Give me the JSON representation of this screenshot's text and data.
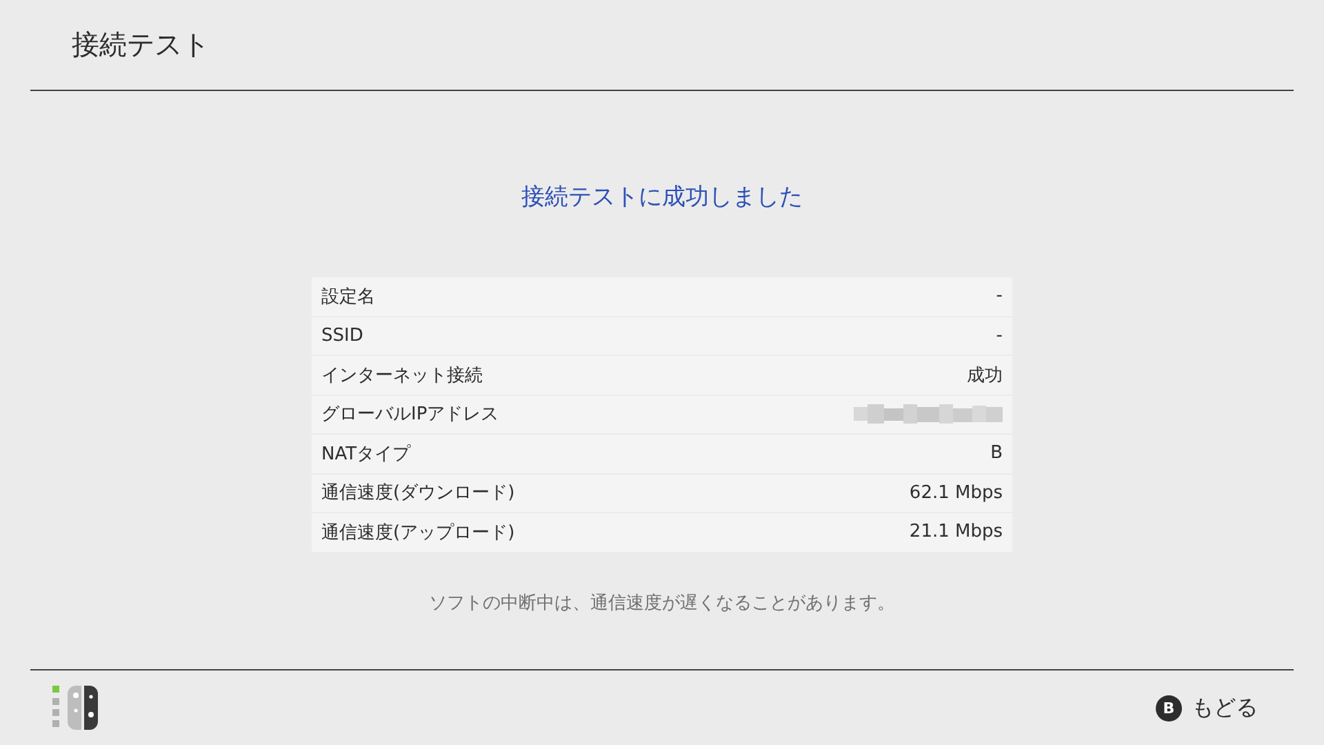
{
  "header": {
    "title": "接続テスト"
  },
  "result_message": "接続テストに成功しました",
  "rows": [
    {
      "kind": "text",
      "label": "設定名",
      "value": "-"
    },
    {
      "kind": "text",
      "label": "SSID",
      "value": "-"
    },
    {
      "kind": "text",
      "label": "インターネット接続",
      "value": "成功"
    },
    {
      "kind": "redacted",
      "label": "グローバルIPアドレス"
    },
    {
      "kind": "text",
      "label": "NATタイプ",
      "value": "B"
    },
    {
      "kind": "text",
      "label": "通信速度(ダウンロード)",
      "value": "62.1 Mbps"
    },
    {
      "kind": "text",
      "label": "通信速度(アップロード)",
      "value": "21.1 Mbps"
    }
  ],
  "note": "ソフトの中断中は、通信速度が遅くなることがあります。",
  "footer": {
    "back_button": {
      "key": "B",
      "label": "もどる"
    }
  }
}
